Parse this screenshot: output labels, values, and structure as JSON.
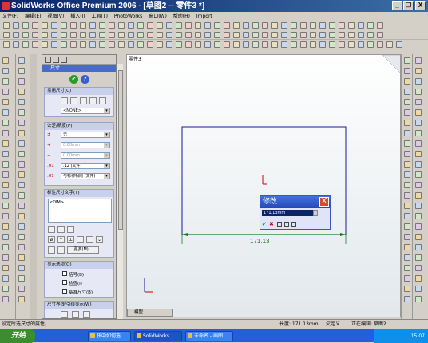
{
  "window": {
    "title": "SolidWorks Office Premium 2006 - [草图2 -- 零件3 *]",
    "min_label": "_",
    "restore_label": "❐",
    "close_label": "X"
  },
  "menu": [
    "文件(F)",
    "编辑(E)",
    "视图(V)",
    "插入(I)",
    "工具(T)",
    "PhotoWorks",
    "窗口(W)",
    "帮助(H)",
    "Import"
  ],
  "panel": {
    "title": "尺寸",
    "ok_label": "✔",
    "help_label": "?",
    "common_header": "常用尺寸(C)",
    "none_option": "<NONE>",
    "tol_header": "公差/精度(P)",
    "tol_type": "无",
    "tol_upper": "0.00mm",
    "tol_lower": "0.00mm",
    "precision": ".12 (文件)",
    "precision2": "与标称相同 (文件)",
    "text_header": "标注尺寸文字(T)",
    "text_value": "<DIM>",
    "more_label": "更多(M)...",
    "display_header": "显示选项(O)",
    "opt1": "括号(B)",
    "opt2": "检查(I)",
    "opt3": "基准尺寸(B)",
    "arrow_header": "尺寸界线/引线显示(W)"
  },
  "canvas": {
    "tab_label": "零件3",
    "dim_value": "171.13",
    "bottom_tab": "模型"
  },
  "modify_dialog": {
    "title": "修改",
    "input_value": "171.13mm",
    "close_label": "X"
  },
  "status": {
    "left": "设定所选尺寸的属性。",
    "length": "长度: 171.13mm",
    "defined": "欠定义",
    "editing": "正在编辑: 草图2"
  },
  "taskbar": {
    "start": "开始",
    "tasks": [
      "快中如何选...",
      "SolidWorks ...",
      "未命名 - 画图"
    ],
    "clock": "15:07"
  },
  "colors": {
    "sketch_blue": "#1a1a9a",
    "dimension_green": "#1a7a2a",
    "origin_red": "#cc0000"
  }
}
